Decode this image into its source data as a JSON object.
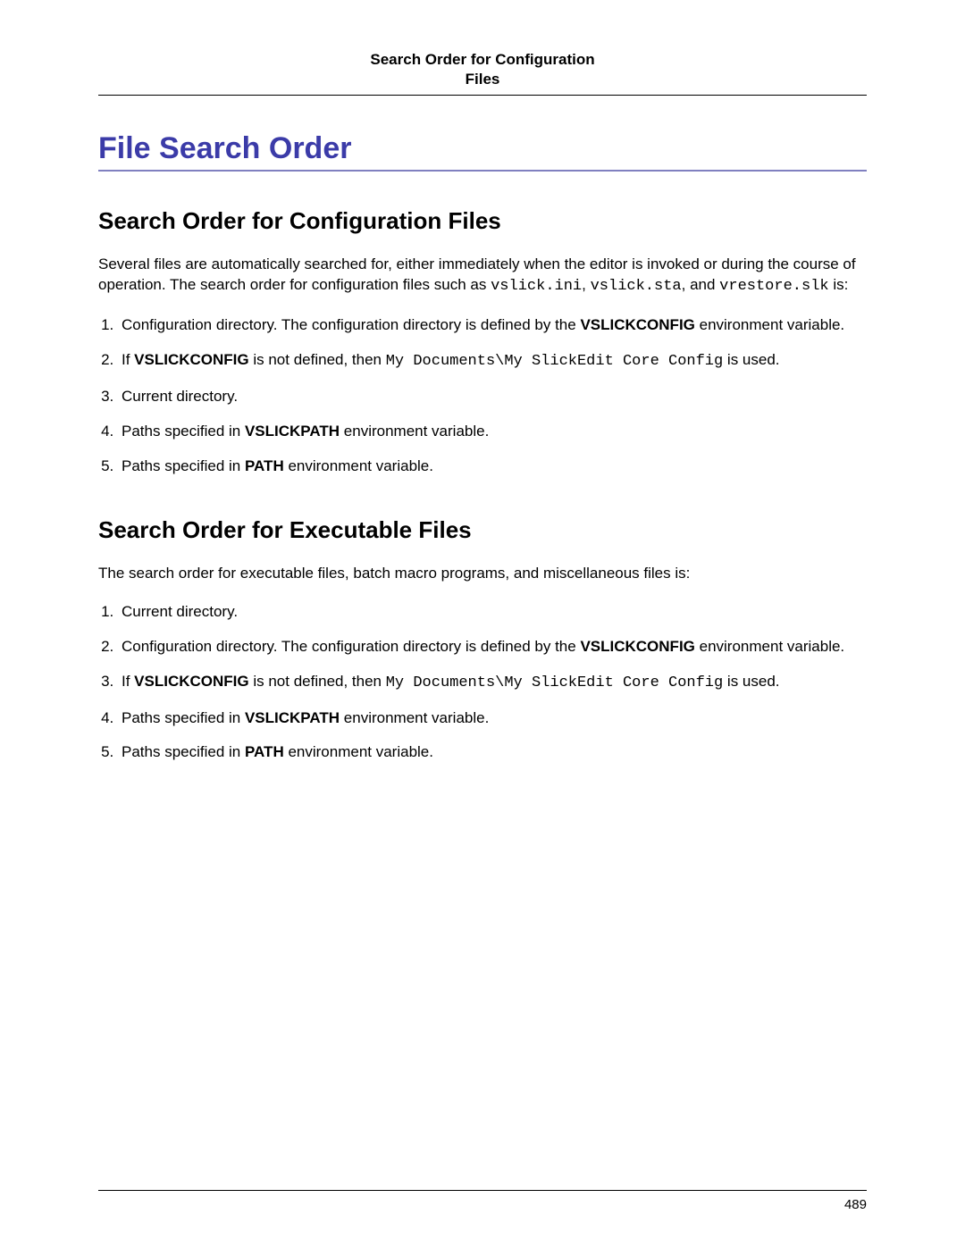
{
  "header": {
    "running_title_line1": "Search Order for Configuration",
    "running_title_line2": "Files"
  },
  "chapter": {
    "title": "File Search Order"
  },
  "section1": {
    "title": "Search Order for Configuration Files",
    "intro_pre": "Several files are automatically searched for, either immediately when the editor is invoked or during the course of operation. The search order for configuration files such as ",
    "code1": "vslick.ini",
    "sep1": ", ",
    "code2": "vslick.sta",
    "sep2": ", and ",
    "code3": "vrestore.slk",
    "intro_post": " is:",
    "items": [
      {
        "prefix": "Configuration directory. The configuration directory is defined by the ",
        "bold": "VSLICKCONFIG",
        "suffix": " environment variable."
      },
      {
        "prefix": "If ",
        "bold": "VSLICKCONFIG",
        "mid": " is not defined, then ",
        "code": "My Documents\\My SlickEdit Core Config",
        "suffix": " is used."
      },
      {
        "text": "Current directory."
      },
      {
        "prefix": "Paths specified in ",
        "bold": "VSLICKPATH",
        "suffix": "  environment variable."
      },
      {
        "prefix": "Paths specified in ",
        "bold": "PATH",
        "suffix": "  environment variable."
      }
    ]
  },
  "section2": {
    "title": "Search Order for Executable Files",
    "intro": "The search order for executable files, batch macro programs, and miscellaneous files is:",
    "items": [
      {
        "text": "Current directory."
      },
      {
        "prefix": "Configuration directory. The configuration directory is defined by the ",
        "bold": "VSLICKCONFIG",
        "suffix": " environment variable."
      },
      {
        "prefix": "If ",
        "bold": "VSLICKCONFIG",
        "mid": " is not defined, then ",
        "code": "My Documents\\My SlickEdit Core Config",
        "suffix": " is used."
      },
      {
        "prefix": "Paths specified in ",
        "bold": "VSLICKPATH",
        "suffix": "  environment variable."
      },
      {
        "prefix": "Paths specified in ",
        "bold": "PATH",
        "suffix": "  environment variable."
      }
    ]
  },
  "footer": {
    "page_number": "489"
  }
}
